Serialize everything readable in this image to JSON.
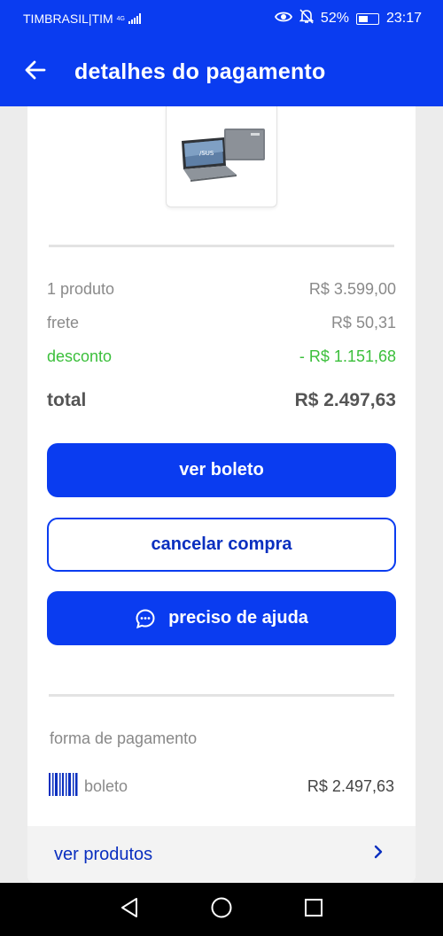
{
  "status_bar": {
    "carrier": "TIMBRASIL|TIM",
    "network": "4G",
    "battery": "52%",
    "time": "23:17"
  },
  "app_bar": {
    "title": "detalhes do pagamento",
    "back_icon": "arrow-left-icon"
  },
  "product": {
    "image": "laptop-image"
  },
  "summary": {
    "items_label": "1 produto",
    "items_value": "R$ 3.599,00",
    "shipping_label": "frete",
    "shipping_value": "R$ 50,31",
    "discount_label": "desconto",
    "discount_value": "- R$ 1.151,68",
    "total_label": "total",
    "total_value": "R$ 2.497,63",
    "discount_color": "#3bbf3b"
  },
  "actions": {
    "view_boleto": "ver boleto",
    "cancel_purchase": "cancelar compra",
    "help": "preciso de ajuda",
    "help_icon": "chat-bubble-icon"
  },
  "payment": {
    "section_label": "forma de pagamento",
    "method_icon": "barcode-icon",
    "method": "boleto",
    "amount": "R$ 2.497,63"
  },
  "footer": {
    "view_products": "ver produtos",
    "chevron_icon": "chevron-right-icon"
  },
  "nav_bar": {
    "back": "triangle-back-icon",
    "home": "circle-home-icon",
    "recents": "square-recents-icon"
  },
  "colors": {
    "brand_blue": "#0a3cf0",
    "background": "#ececec"
  }
}
